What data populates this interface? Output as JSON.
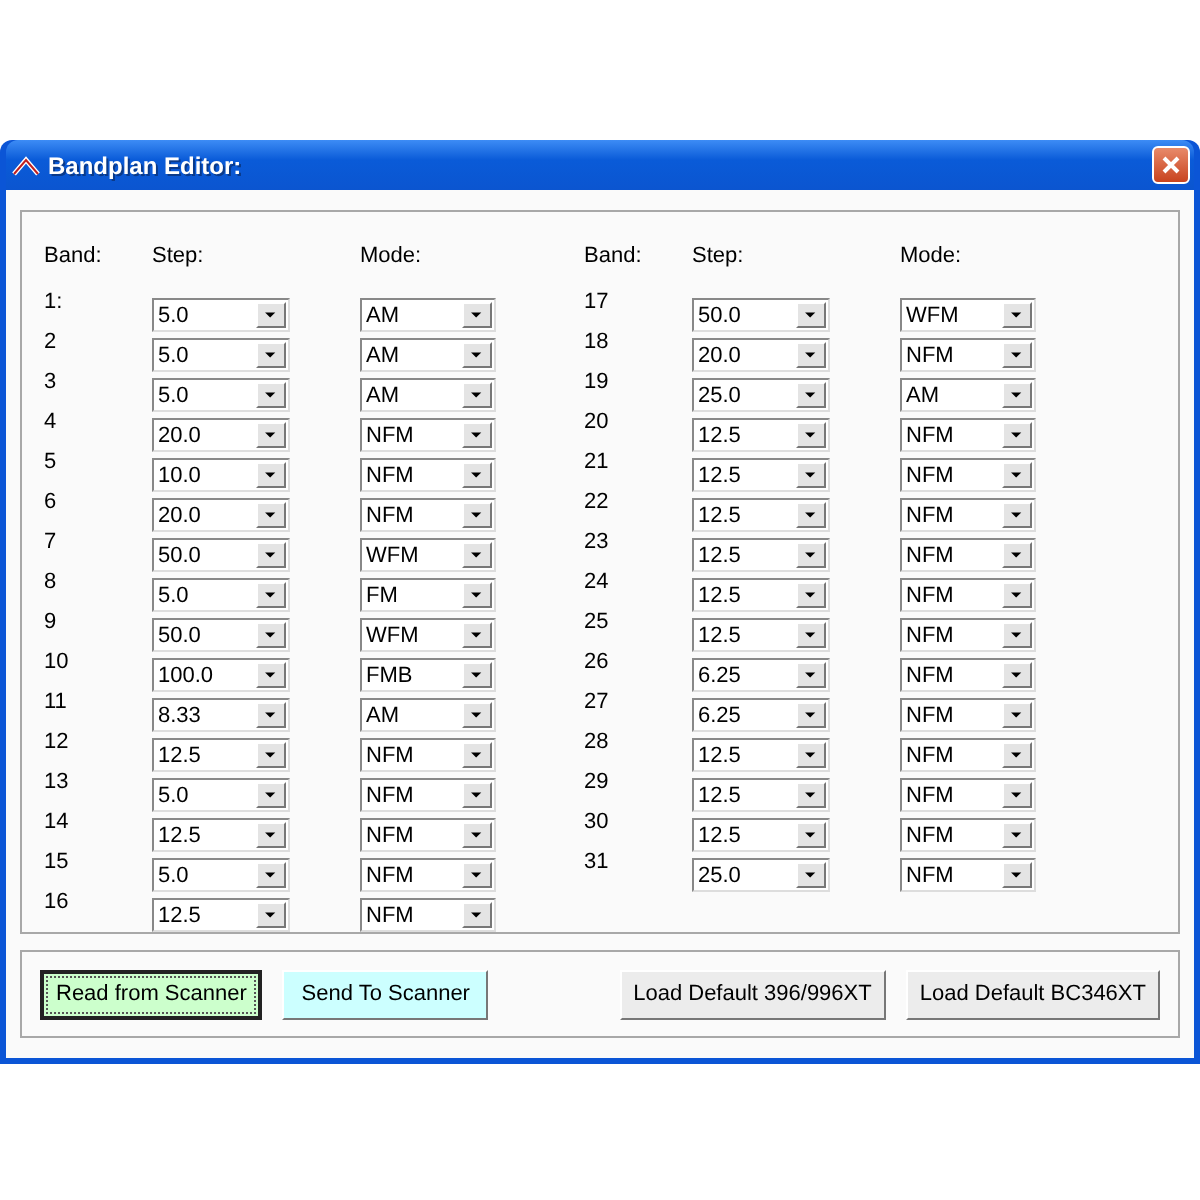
{
  "window": {
    "title": "Bandplan Editor:"
  },
  "columns": [
    {
      "headers": {
        "band": "Band:",
        "step": "Step:",
        "mode": "Mode:"
      },
      "rows": [
        {
          "band": "1:",
          "step": "5.0",
          "mode": "AM"
        },
        {
          "band": "2",
          "step": "5.0",
          "mode": "AM"
        },
        {
          "band": "3",
          "step": "5.0",
          "mode": "AM"
        },
        {
          "band": "4",
          "step": "20.0",
          "mode": "NFM"
        },
        {
          "band": "5",
          "step": "10.0",
          "mode": "NFM"
        },
        {
          "band": "6",
          "step": "20.0",
          "mode": "NFM"
        },
        {
          "band": "7",
          "step": "50.0",
          "mode": "WFM"
        },
        {
          "band": "8",
          "step": "5.0",
          "mode": "FM"
        },
        {
          "band": "9",
          "step": "50.0",
          "mode": "WFM"
        },
        {
          "band": "10",
          "step": "100.0",
          "mode": "FMB"
        },
        {
          "band": "11",
          "step": "8.33",
          "mode": "AM"
        },
        {
          "band": "12",
          "step": "12.5",
          "mode": "NFM"
        },
        {
          "band": "13",
          "step": "5.0",
          "mode": "NFM"
        },
        {
          "band": "14",
          "step": "12.5",
          "mode": "NFM"
        },
        {
          "band": "15",
          "step": "5.0",
          "mode": "NFM"
        },
        {
          "band": "16",
          "step": "12.5",
          "mode": "NFM"
        }
      ]
    },
    {
      "headers": {
        "band": "Band:",
        "step": "Step:",
        "mode": "Mode:"
      },
      "rows": [
        {
          "band": "17",
          "step": "50.0",
          "mode": "WFM"
        },
        {
          "band": "18",
          "step": "20.0",
          "mode": "NFM"
        },
        {
          "band": "19",
          "step": "25.0",
          "mode": "AM"
        },
        {
          "band": "20",
          "step": "12.5",
          "mode": "NFM"
        },
        {
          "band": "21",
          "step": "12.5",
          "mode": "NFM"
        },
        {
          "band": "22",
          "step": "12.5",
          "mode": "NFM"
        },
        {
          "band": "23",
          "step": "12.5",
          "mode": "NFM"
        },
        {
          "band": "24",
          "step": "12.5",
          "mode": "NFM"
        },
        {
          "band": "25",
          "step": "12.5",
          "mode": "NFM"
        },
        {
          "band": "26",
          "step": "6.25",
          "mode": "NFM"
        },
        {
          "band": "27",
          "step": "6.25",
          "mode": "NFM"
        },
        {
          "band": "28",
          "step": "12.5",
          "mode": "NFM"
        },
        {
          "band": "29",
          "step": "12.5",
          "mode": "NFM"
        },
        {
          "band": "30",
          "step": "12.5",
          "mode": "NFM"
        },
        {
          "band": "31",
          "step": "25.0",
          "mode": "NFM"
        }
      ]
    }
  ],
  "buttons": [
    {
      "label": "Read from Scanner",
      "color": "#ccffcc",
      "focused": true
    },
    {
      "label": "Send To Scanner",
      "color": "#ccffff",
      "focused": false
    },
    {
      "label": "Load Default 396/996XT",
      "color": "#ececec",
      "focused": false
    },
    {
      "label": "Load Default BC346XT",
      "color": "#ececec",
      "focused": false
    }
  ]
}
